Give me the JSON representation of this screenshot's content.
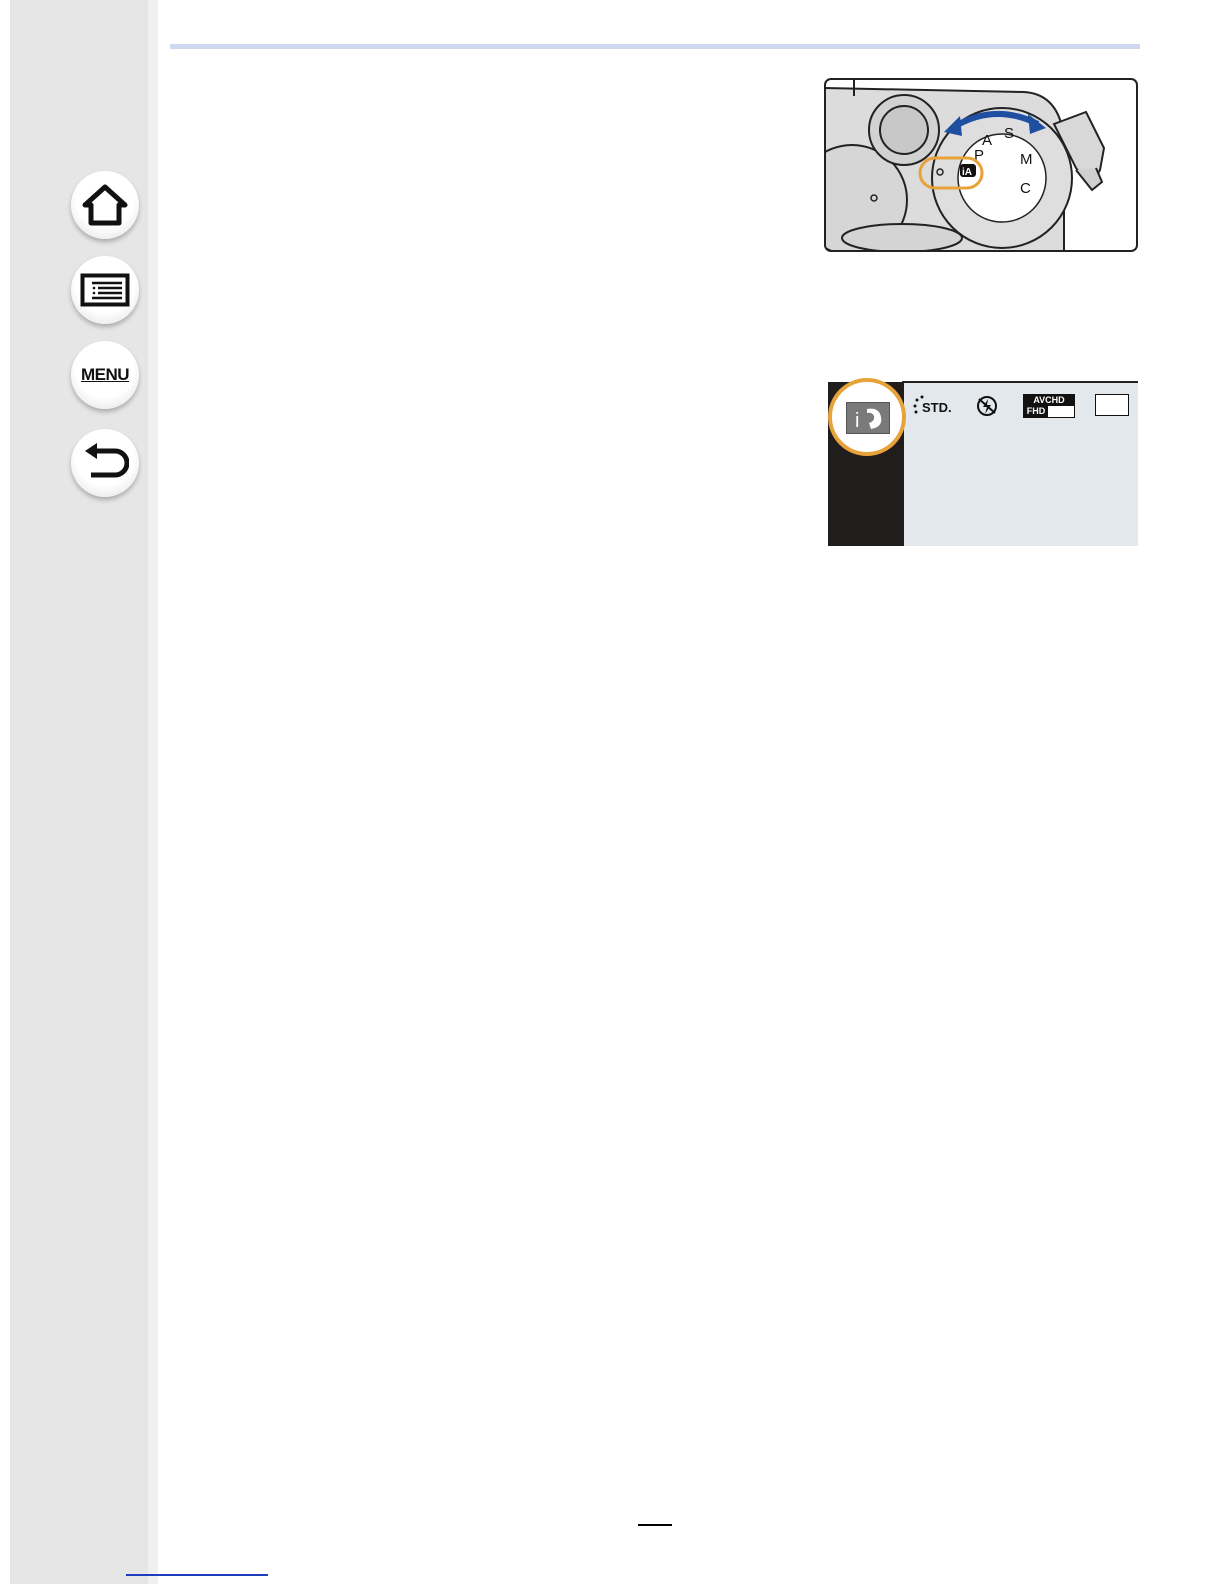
{
  "sidebar": {
    "buttons": [
      {
        "id": "home",
        "icon": "home-icon"
      },
      {
        "id": "contents",
        "icon": "list-icon"
      },
      {
        "id": "menu",
        "label": "MENU",
        "icon": "menu-text-icon"
      },
      {
        "id": "back",
        "icon": "return-arrow-icon"
      }
    ]
  },
  "dial_illustration": {
    "dial_labels": [
      "P",
      "A",
      "S",
      "M",
      "C",
      "iA"
    ],
    "arrow_color": "#1f4fa0",
    "highlight_color": "#e8a23a"
  },
  "screen_illustration": {
    "mode_icon": "intelligent-auto-icon",
    "photo_style_label": "STD.",
    "format_label_top": "AVCHD",
    "format_label_bottom": "FHD",
    "flash_icon": "flash-off-icon",
    "highlight_color": "#e8a23a"
  },
  "colors": {
    "header_rule": "#cfd8f0",
    "link": "#1d3fbf"
  }
}
